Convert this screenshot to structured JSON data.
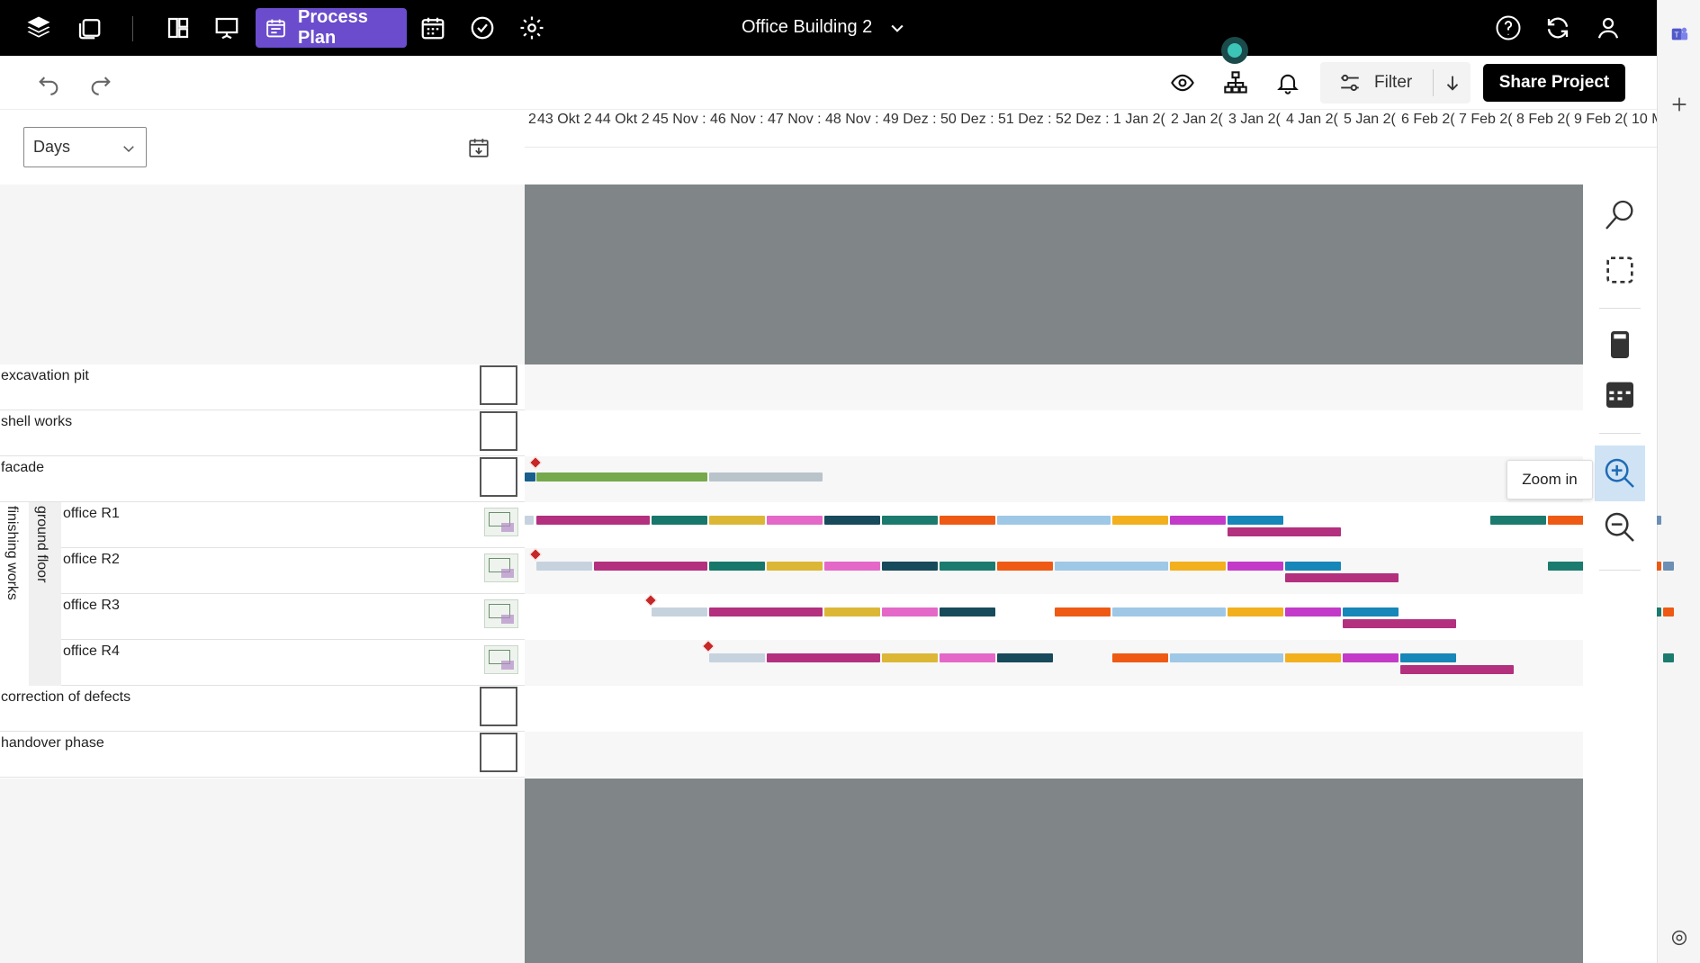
{
  "topbar": {
    "process_plan_label": "Process Plan",
    "project_name": "Office Building 2"
  },
  "toolbar": {
    "filter_label": "Filter",
    "share_label": "Share Project"
  },
  "view": {
    "scale_value": "Days"
  },
  "timeline": {
    "weeks": [
      "2",
      "43 Okt 2",
      "44 Okt 2",
      "45 Nov :",
      "46 Nov :",
      "47 Nov :",
      "48 Nov :",
      "49 Dez :",
      "50 Dez :",
      "51 Dez :",
      "52 Dez :",
      "1 Jan 2(",
      "2 Jan 2(",
      "3 Jan 2(",
      "4 Jan 2(",
      "5 Jan 2(",
      "6 Feb 2(",
      "7 Feb 2(",
      "8 Feb 2(",
      "9 Feb 2(",
      "10 M"
    ]
  },
  "rows": {
    "excavation": "excavation pit",
    "shell": "shell works",
    "facade": "facade",
    "finishing": "finishing works",
    "ground_floor": "ground floor",
    "office_r1": "office R1",
    "office_r2": "office R2",
    "office_r3": "office R3",
    "office_r4": "office R4",
    "defects": "correction of defects",
    "handover": "handover phase"
  },
  "tooltip": {
    "zoom_in": "Zoom in"
  },
  "colors": {
    "accent": "#6a4ccd",
    "timeline_grey": "#808688"
  }
}
